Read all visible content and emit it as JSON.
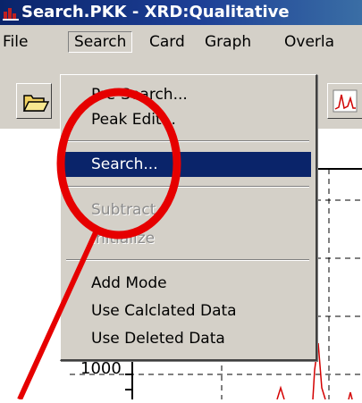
{
  "window": {
    "title": "Search.PKK - XRD:Qualitative"
  },
  "menubar": {
    "items": [
      "File",
      "Search",
      "Card",
      "Graph",
      "Overla"
    ]
  },
  "search_menu": {
    "items": [
      {
        "label": "Pre-Search...",
        "state": "normal"
      },
      {
        "label": "Peak Edit...",
        "state": "normal"
      },
      {
        "label": "Search...",
        "state": "highlighted"
      },
      {
        "label": "Subtract",
        "state": "disabled"
      },
      {
        "label": "Initialize",
        "state": "disabled"
      },
      {
        "label": "Add Mode",
        "state": "normal"
      },
      {
        "label": "Use Calclated Data",
        "state": "normal"
      },
      {
        "label": "Use Deleted Data",
        "state": "normal"
      }
    ]
  },
  "graph": {
    "y_tick_label": "1000"
  },
  "colors": {
    "highlight": "#0a246a",
    "annotation": "#e60000",
    "plot_line": "#d40000"
  }
}
